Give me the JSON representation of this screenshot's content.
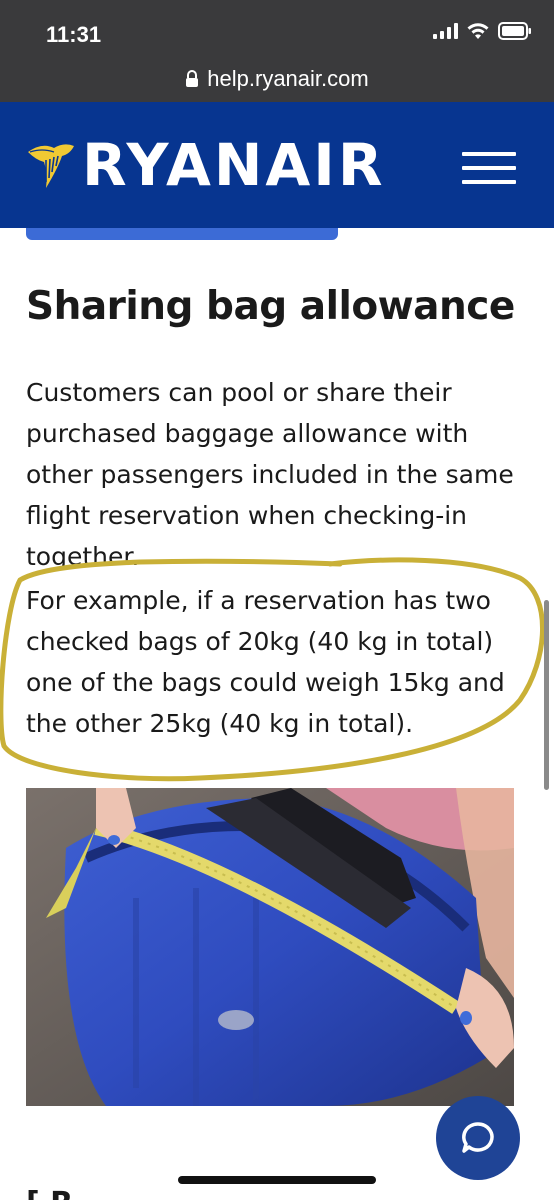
{
  "status_bar": {
    "time": "11:31"
  },
  "browser": {
    "url": "help.ryanair.com",
    "lock_icon": "lock-icon"
  },
  "header": {
    "logo_text": "RYANAIR",
    "background": "#073590",
    "menu_icon": "hamburger-menu-icon"
  },
  "article": {
    "title": "Sharing bag allowance",
    "paragraph1": "Customers can pool or share their purchased baggage allowance with other passengers included in the same flight reservation when checking-in together.",
    "paragraph2": "For example, if a reservation has two checked bags of 20kg (40 kg in total) one of the bags could weigh 15kg and the other 25kg (40 kg in total).",
    "highlight_color": "#c9b037",
    "image": "blue-suitcase-being-measured-with-tape"
  },
  "next_heading_partial": "[ R",
  "chat": {
    "icon": "chat-bubble-icon",
    "color": "#1f4496"
  }
}
